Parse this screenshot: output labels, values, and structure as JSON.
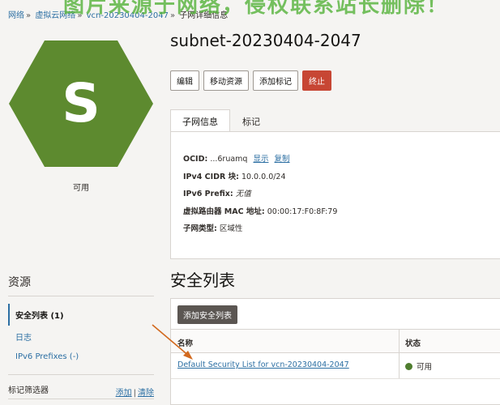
{
  "watermark": "图片来源于网络，侵权联系站长删除！",
  "breadcrumb": {
    "items": [
      "网络",
      "虚拟云网络",
      "vcn-20230404-2047"
    ],
    "current": "子网详细信息",
    "separator": "»"
  },
  "avatar": {
    "letter": "S",
    "color": "#5d8a2f"
  },
  "status_label": "可用",
  "title": "subnet-20230404-2047",
  "actions": {
    "edit": "编辑",
    "move": "移动资源",
    "add_tag": "添加标记",
    "terminate": "终止"
  },
  "tabs": {
    "info": "子网信息",
    "tags": "标记"
  },
  "details": {
    "ocid_label": "OCID:",
    "ocid_value": "...6ruamq",
    "ocid_show": "显示",
    "ocid_copy": "复制",
    "cidr_label": "IPv4 CIDR 块:",
    "cidr_value": "10.0.0.0/24",
    "ipv6_label": "IPv6 Prefix:",
    "ipv6_value": "无值",
    "mac_label": "虚拟路由器 MAC 地址:",
    "mac_value": "00:00:17:F0:8F:79",
    "type_label": "子网类型:",
    "type_value": "区域性"
  },
  "resources": {
    "heading": "资源",
    "items": [
      "安全列表 (1)",
      "日志",
      "IPv6 Prefixes (-)"
    ]
  },
  "tag_filter": {
    "label": "标记筛选器",
    "add": "添加",
    "separator": "|",
    "clear": "清除"
  },
  "security": {
    "heading": "安全列表",
    "add_button": "添加安全列表",
    "columns": [
      "名称",
      "状态"
    ],
    "rows": [
      {
        "name": "Default Security List for vcn-20230404-2047",
        "status": "可用"
      }
    ]
  },
  "colors": {
    "accent": "#2c6fa3",
    "danger": "#c74634",
    "available": "#4f7d2f",
    "annotation_arrow": "#d2691e"
  }
}
